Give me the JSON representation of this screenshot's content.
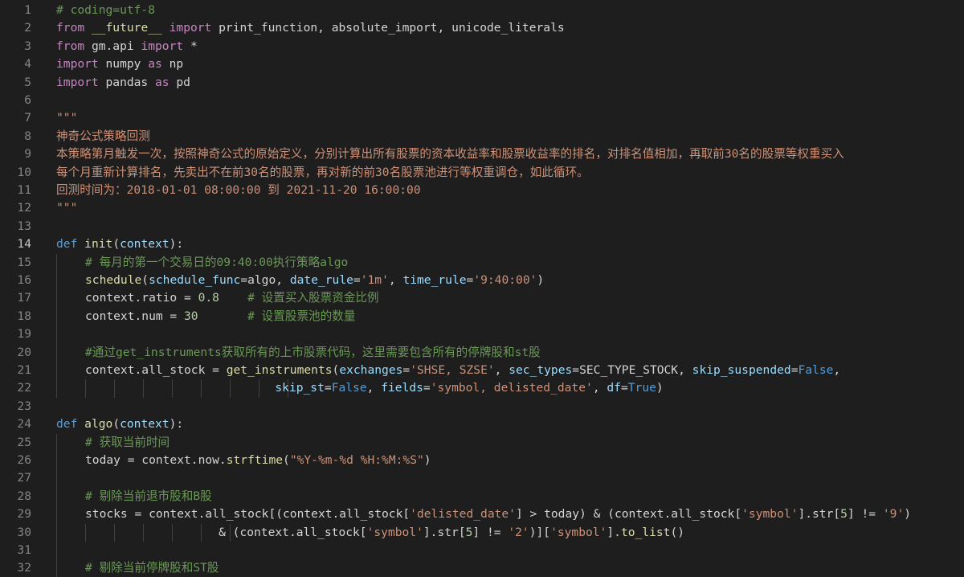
{
  "editor": {
    "active_line": 14,
    "lines": [
      {
        "n": "1",
        "indent": 0,
        "tokens": [
          [
            "cmt",
            "# coding=utf-8"
          ]
        ]
      },
      {
        "n": "2",
        "indent": 0,
        "tokens": [
          [
            "kw2",
            "from"
          ],
          [
            "id",
            " "
          ],
          [
            "dunder",
            "__future__"
          ],
          [
            "id",
            " "
          ],
          [
            "kw2",
            "import"
          ],
          [
            "id",
            " print_function, absolute_import, unicode_literals"
          ]
        ]
      },
      {
        "n": "3",
        "indent": 0,
        "tokens": [
          [
            "kw2",
            "from"
          ],
          [
            "id",
            " gm.api "
          ],
          [
            "kw2",
            "import"
          ],
          [
            "id",
            " *"
          ]
        ]
      },
      {
        "n": "4",
        "indent": 0,
        "tokens": [
          [
            "kw2",
            "import"
          ],
          [
            "id",
            " numpy "
          ],
          [
            "kw2",
            "as"
          ],
          [
            "id",
            " np"
          ]
        ]
      },
      {
        "n": "5",
        "indent": 0,
        "tokens": [
          [
            "kw2",
            "import"
          ],
          [
            "id",
            " pandas "
          ],
          [
            "kw2",
            "as"
          ],
          [
            "id",
            " pd"
          ]
        ]
      },
      {
        "n": "6",
        "indent": 0,
        "tokens": []
      },
      {
        "n": "7",
        "indent": 0,
        "tokens": [
          [
            "str",
            "\"\"\""
          ]
        ]
      },
      {
        "n": "8",
        "indent": 0,
        "tokens": [
          [
            "str",
            "神奇公式策略回测"
          ]
        ]
      },
      {
        "n": "9",
        "indent": 0,
        "tokens": [
          [
            "str",
            "本策略第月触发一次，按照神奇公式的原始定义，分别计算出所有股票的资本收益率和股票收益率的排名，对排名值相加，再取前30名的股票等权重买入"
          ]
        ]
      },
      {
        "n": "10",
        "indent": 0,
        "tokens": [
          [
            "str",
            "每个月重新计算排名，先卖出不在前30名的股票，再对新的前30名股票池进行等权重调仓，如此循环。"
          ]
        ]
      },
      {
        "n": "11",
        "indent": 0,
        "tokens": [
          [
            "str",
            "回测时间为：2018-01-01 08:00:00 到 2021-11-20 16:00:00"
          ]
        ]
      },
      {
        "n": "12",
        "indent": 0,
        "tokens": [
          [
            "str",
            "\"\"\""
          ]
        ]
      },
      {
        "n": "13",
        "indent": 0,
        "tokens": []
      },
      {
        "n": "14",
        "indent": 0,
        "tokens": [
          [
            "kw",
            "def"
          ],
          [
            "id",
            " "
          ],
          [
            "fn",
            "init"
          ],
          [
            "id",
            "("
          ],
          [
            "param",
            "context"
          ],
          [
            "id",
            "):"
          ]
        ]
      },
      {
        "n": "15",
        "indent": 1,
        "tokens": [
          [
            "cmt",
            "# 每月的第一个交易日的09:40:00执行策略algo"
          ]
        ]
      },
      {
        "n": "16",
        "indent": 1,
        "tokens": [
          [
            "fn",
            "schedule"
          ],
          [
            "id",
            "("
          ],
          [
            "param",
            "schedule_func"
          ],
          [
            "id",
            "=algo, "
          ],
          [
            "param",
            "date_rule"
          ],
          [
            "id",
            "="
          ],
          [
            "str",
            "'1m'"
          ],
          [
            "id",
            ", "
          ],
          [
            "param",
            "time_rule"
          ],
          [
            "id",
            "="
          ],
          [
            "str",
            "'9:40:00'"
          ],
          [
            "id",
            ")"
          ]
        ]
      },
      {
        "n": "17",
        "indent": 1,
        "tokens": [
          [
            "id",
            "context.ratio = "
          ],
          [
            "num",
            "0.8"
          ],
          [
            "id",
            "    "
          ],
          [
            "cmt",
            "# 设置买入股票资金比例"
          ]
        ]
      },
      {
        "n": "18",
        "indent": 1,
        "tokens": [
          [
            "id",
            "context.num = "
          ],
          [
            "num",
            "30"
          ],
          [
            "id",
            "       "
          ],
          [
            "cmt",
            "# 设置股票池的数量"
          ]
        ]
      },
      {
        "n": "19",
        "indent": 1,
        "tokens": []
      },
      {
        "n": "20",
        "indent": 1,
        "tokens": [
          [
            "cmt",
            "#通过get_instruments获取所有的上市股票代码，这里需要包含所有的停牌股和st股"
          ]
        ]
      },
      {
        "n": "21",
        "indent": 1,
        "tokens": [
          [
            "id",
            "context.all_stock = "
          ],
          [
            "fn",
            "get_instruments"
          ],
          [
            "id",
            "("
          ],
          [
            "param",
            "exchanges"
          ],
          [
            "id",
            "="
          ],
          [
            "str",
            "'SHSE, SZSE'"
          ],
          [
            "id",
            ", "
          ],
          [
            "param",
            "sec_types"
          ],
          [
            "id",
            "=SEC_TYPE_STOCK, "
          ],
          [
            "param",
            "skip_suspended"
          ],
          [
            "id",
            "="
          ],
          [
            "const",
            "False"
          ],
          [
            "id",
            ","
          ]
        ]
      },
      {
        "n": "22",
        "indent": 9,
        "tokens": [
          [
            "id",
            "                               "
          ],
          [
            "param",
            "skip_st"
          ],
          [
            "id",
            "="
          ],
          [
            "const",
            "False"
          ],
          [
            "id",
            ", "
          ],
          [
            "param",
            "fields"
          ],
          [
            "id",
            "="
          ],
          [
            "str",
            "'symbol, delisted_date'"
          ],
          [
            "id",
            ", "
          ],
          [
            "param",
            "df"
          ],
          [
            "id",
            "="
          ],
          [
            "const",
            "True"
          ],
          [
            "id",
            ")"
          ]
        ]
      },
      {
        "n": "23",
        "indent": 0,
        "tokens": []
      },
      {
        "n": "24",
        "indent": 0,
        "tokens": [
          [
            "kw",
            "def"
          ],
          [
            "id",
            " "
          ],
          [
            "fn",
            "algo"
          ],
          [
            "id",
            "("
          ],
          [
            "param",
            "context"
          ],
          [
            "id",
            "):"
          ]
        ]
      },
      {
        "n": "25",
        "indent": 1,
        "tokens": [
          [
            "cmt",
            "# 获取当前时间"
          ]
        ]
      },
      {
        "n": "26",
        "indent": 1,
        "tokens": [
          [
            "id",
            "today = context.now."
          ],
          [
            "fn",
            "strftime"
          ],
          [
            "id",
            "("
          ],
          [
            "str",
            "\"%Y-%m-%d %H:%M:%S\""
          ],
          [
            "id",
            ")"
          ]
        ]
      },
      {
        "n": "27",
        "indent": 1,
        "tokens": []
      },
      {
        "n": "28",
        "indent": 1,
        "tokens": [
          [
            "cmt",
            "# 剔除当前退市股和B股"
          ]
        ]
      },
      {
        "n": "29",
        "indent": 1,
        "tokens": [
          [
            "id",
            "stocks = context.all_stock[(context.all_stock["
          ],
          [
            "str",
            "'delisted_date'"
          ],
          [
            "id",
            "] > today) & (context.all_stock["
          ],
          [
            "str",
            "'symbol'"
          ],
          [
            "id",
            "].str["
          ],
          [
            "num",
            "5"
          ],
          [
            "id",
            "] != "
          ],
          [
            "str",
            "'9'"
          ],
          [
            "id",
            ")"
          ]
        ]
      },
      {
        "n": "30",
        "indent": 7,
        "tokens": [
          [
            "id",
            "                       & (context.all_stock["
          ],
          [
            "str",
            "'symbol'"
          ],
          [
            "id",
            "].str["
          ],
          [
            "num",
            "5"
          ],
          [
            "id",
            "] != "
          ],
          [
            "str",
            "'2'"
          ],
          [
            "id",
            ")]["
          ],
          [
            "str",
            "'symbol'"
          ],
          [
            "id",
            "]."
          ],
          [
            "fn",
            "to_list"
          ],
          [
            "id",
            "()"
          ]
        ]
      },
      {
        "n": "31",
        "indent": 1,
        "tokens": []
      },
      {
        "n": "32",
        "indent": 1,
        "tokens": [
          [
            "cmt",
            "# 剔除当前停牌股和ST股"
          ]
        ]
      }
    ]
  },
  "colors": {
    "background": "#1e1e1e",
    "line_number": "#858585",
    "keyword": "#569cd6",
    "control_keyword": "#c586c0",
    "function": "#dcdcaa",
    "string": "#ce9178",
    "number": "#b5cea8",
    "comment": "#6a9955",
    "parameter": "#9cdcfe"
  }
}
